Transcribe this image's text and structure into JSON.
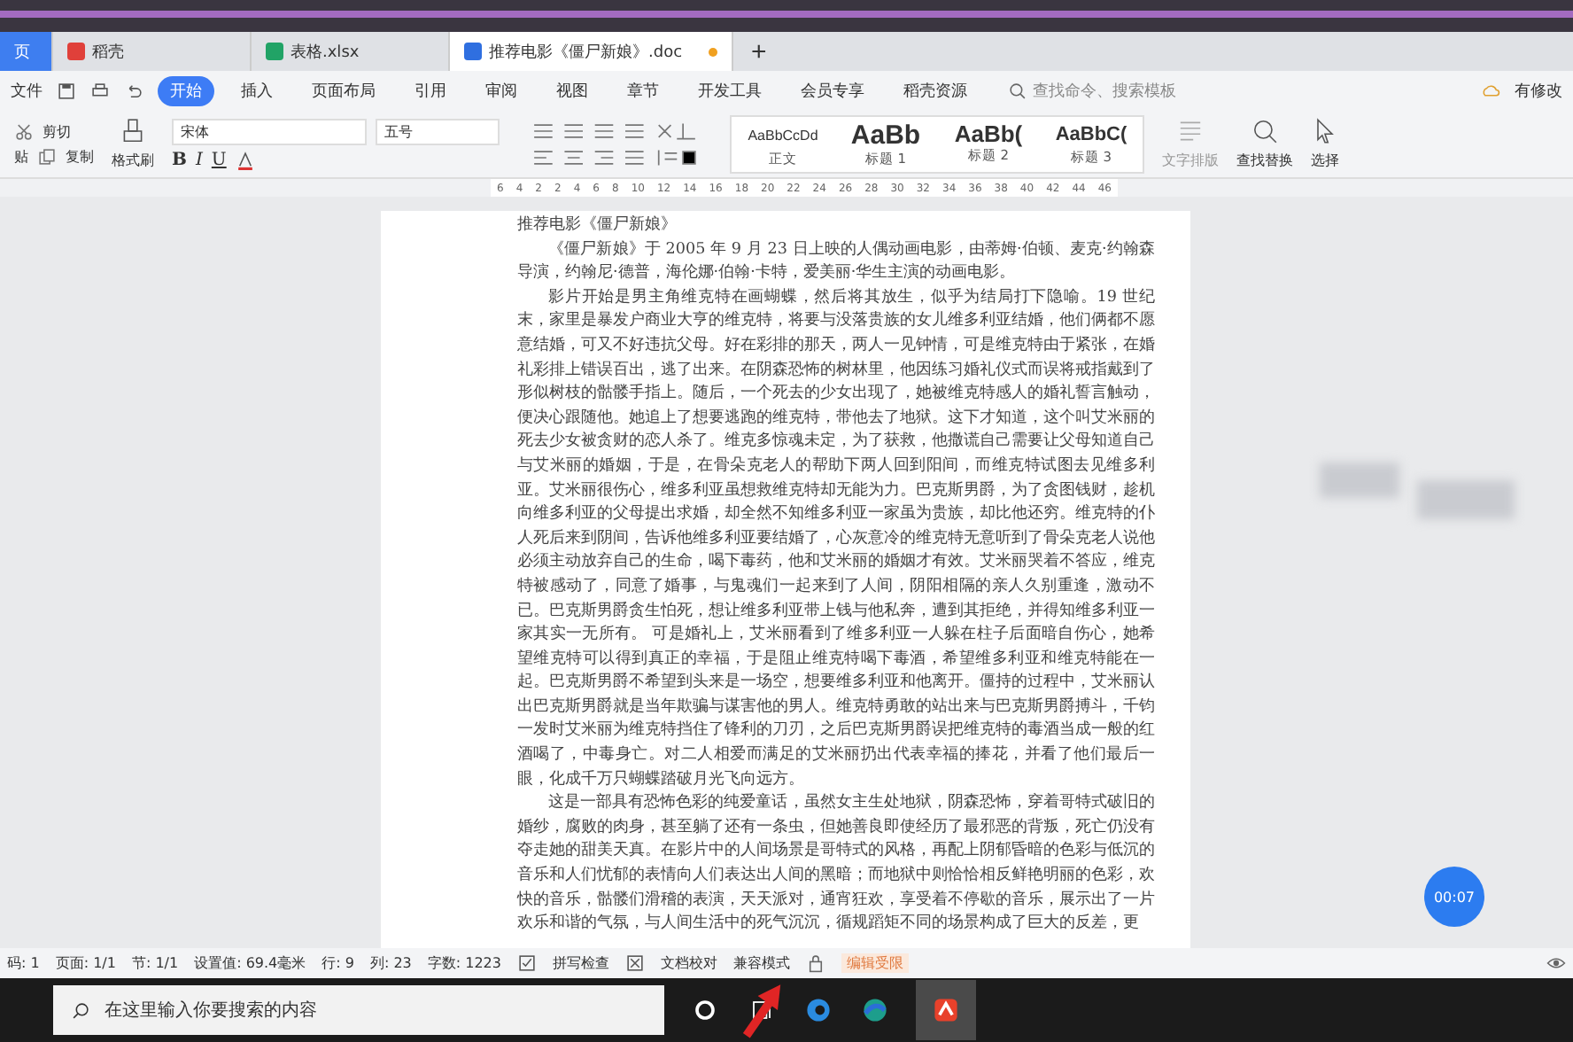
{
  "tabs": [
    {
      "label": "页",
      "kind": "home",
      "selected": false
    },
    {
      "label": "稻壳",
      "kind": "docer",
      "selected": false
    },
    {
      "label": "表格.xlsx",
      "kind": "sheet",
      "selected": false
    },
    {
      "label": "推荐电影《僵尸新娘》.doc",
      "kind": "doc",
      "selected": true
    }
  ],
  "new_tab": "+",
  "menu": {
    "file": "文件",
    "items": [
      {
        "label": "开始",
        "selected": true
      },
      {
        "label": "插入",
        "selected": false
      },
      {
        "label": "页面布局",
        "selected": false
      },
      {
        "label": "引用",
        "selected": false
      },
      {
        "label": "审阅",
        "selected": false
      },
      {
        "label": "视图",
        "selected": false
      },
      {
        "label": "章节",
        "selected": false
      },
      {
        "label": "开发工具",
        "selected": false
      },
      {
        "label": "会员专享",
        "selected": false
      },
      {
        "label": "稻壳资源",
        "selected": false
      }
    ],
    "search_placeholder": "查找命令、搜索模板",
    "changes": "有修改"
  },
  "ribbon": {
    "cut": "剪切",
    "copy": "复制",
    "paste": "贴",
    "format_painter": "格式刷",
    "font": "宋体",
    "size": "五号",
    "format_letters": [
      "B",
      "I",
      "U"
    ],
    "styles": [
      {
        "sample": "AaBbCcDd",
        "name": "正文",
        "kind": "normal"
      },
      {
        "sample": "AaBb",
        "name": "标题 1",
        "kind": "h1"
      },
      {
        "sample": "AaBb(",
        "name": "标题 2",
        "kind": "h2"
      },
      {
        "sample": "AaBbC(",
        "name": "标题 3",
        "kind": "h3"
      }
    ],
    "layout": "文字排版",
    "find": "查找替换",
    "select": "选择"
  },
  "ruler": [
    "6",
    "4",
    "2",
    "2",
    "4",
    "6",
    "8",
    "10",
    "12",
    "14",
    "16",
    "18",
    "20",
    "22",
    "24",
    "26",
    "28",
    "30",
    "32",
    "34",
    "36",
    "38",
    "40",
    "42",
    "44",
    "46"
  ],
  "document": {
    "title": "推荐电影《僵尸新娘》",
    "paragraphs": [
      "《僵尸新娘》于 2005 年 9 月 23 日上映的人偶动画电影，由蒂姆·伯顿、麦克·约翰森导演，约翰尼·德普，海伦娜·伯翰·卡特，爱美丽·华生主演的动画电影。",
      "影片开始是男主角维克特在画蝴蝶，然后将其放生，似乎为结局打下隐喻。19 世纪末，家里是暴发户商业大亨的维克特，将要与没落贵族的女儿维多利亚结婚，他们俩都不愿意结婚，可又不好违抗父母。好在彩排的那天，两人一见钟情，可是维克特由于紧张，在婚礼彩排上错误百出，逃了出来。在阴森恐怖的树林里，他因练习婚礼仪式而误将戒指戴到了形似树枝的骷髅手指上。随后，一个死去的少女出现了，她被维克特感人的婚礼誓言触动，便决心跟随他。她追上了想要逃跑的维克特，带他去了地狱。这下才知道，这个叫艾米丽的死去少女被贪财的恋人杀了。维克多惊魂未定，为了获救，他撒谎自己需要让父母知道自己与艾米丽的婚姻，于是，在骨朵克老人的帮助下两人回到阳间，而维克特试图去见维多利亚。艾米丽很伤心，维多利亚虽想救维克特却无能为力。巴克斯男爵，为了贪图钱财，趁机向维多利亚的父母提出求婚，却全然不知维多利亚一家虽为贵族，却比他还穷。维克特的仆人死后来到阴间，告诉他维多利亚要结婚了，心灰意冷的维克特无意听到了骨朵克老人说他必须主动放弃自己的生命，喝下毒药，他和艾米丽的婚姻才有效。艾米丽哭着不答应，维克特被感动了，同意了婚事，与鬼魂们一起来到了人间，阴阳相隔的亲人久别重逢，激动不已。巴克斯男爵贪生怕死，想让维多利亚带上钱与他私奔，遭到其拒绝，并得知维多利亚一家其实一无所有。 可是婚礼上，艾米丽看到了维多利亚一人躲在柱子后面暗自伤心，她希望维克特可以得到真正的幸福，于是阻止维克特喝下毒酒，希望维多利亚和维克特能在一起。巴克斯男爵不希望到头来是一场空，想要维多利亚和他离开。僵持的过程中，艾米丽认出巴克斯男爵就是当年欺骗与谋害他的男人。维克特勇敢的站出来与巴克斯男爵搏斗，千钧一发时艾米丽为维克特挡住了锋利的刀刃，之后巴克斯男爵误把维克特的毒酒当成一般的红酒喝了，中毒身亡。对二人相爱而满足的艾米丽扔出代表幸福的捧花，并看了他们最后一眼，化成千万只蝴蝶踏破月光飞向远方。",
      "这是一部具有恐怖色彩的纯爱童话，虽然女主生处地狱，阴森恐怖，穿着哥特式破旧的婚纱，腐败的肉身，甚至躺了还有一条虫，但她善良即使经历了最邪恶的背叛，死亡仍没有夺走她的甜美天真。在影片中的人间场景是哥特式的风格，再配上阴郁昏暗的色彩与低沉的音乐和人们忧郁的表情向人们表达出人间的黑暗；而地狱中则恰恰相反鲜艳明丽的色彩，欢快的音乐，骷髅们滑稽的表演，天天派对，通宵狂欢，享受着不停歇的音乐，展示出了一片欢乐和谐的气氛，与人间生活中的死气沉沉，循规蹈矩不同的场景构成了巨大的反差，更"
    ]
  },
  "timer": "00:07",
  "status_bar": {
    "items": [
      "码: 1",
      "页面: 1/1",
      "节: 1/1",
      "设置值: 69.4毫米",
      "行: 9",
      "列: 23",
      "字数: 1223"
    ],
    "spell": "拼写检查",
    "proof": "文档校对",
    "compat": "兼容模式",
    "restricted": "编辑受限"
  },
  "taskbar": {
    "search_placeholder": "在这里输入你要搜索的内容"
  }
}
